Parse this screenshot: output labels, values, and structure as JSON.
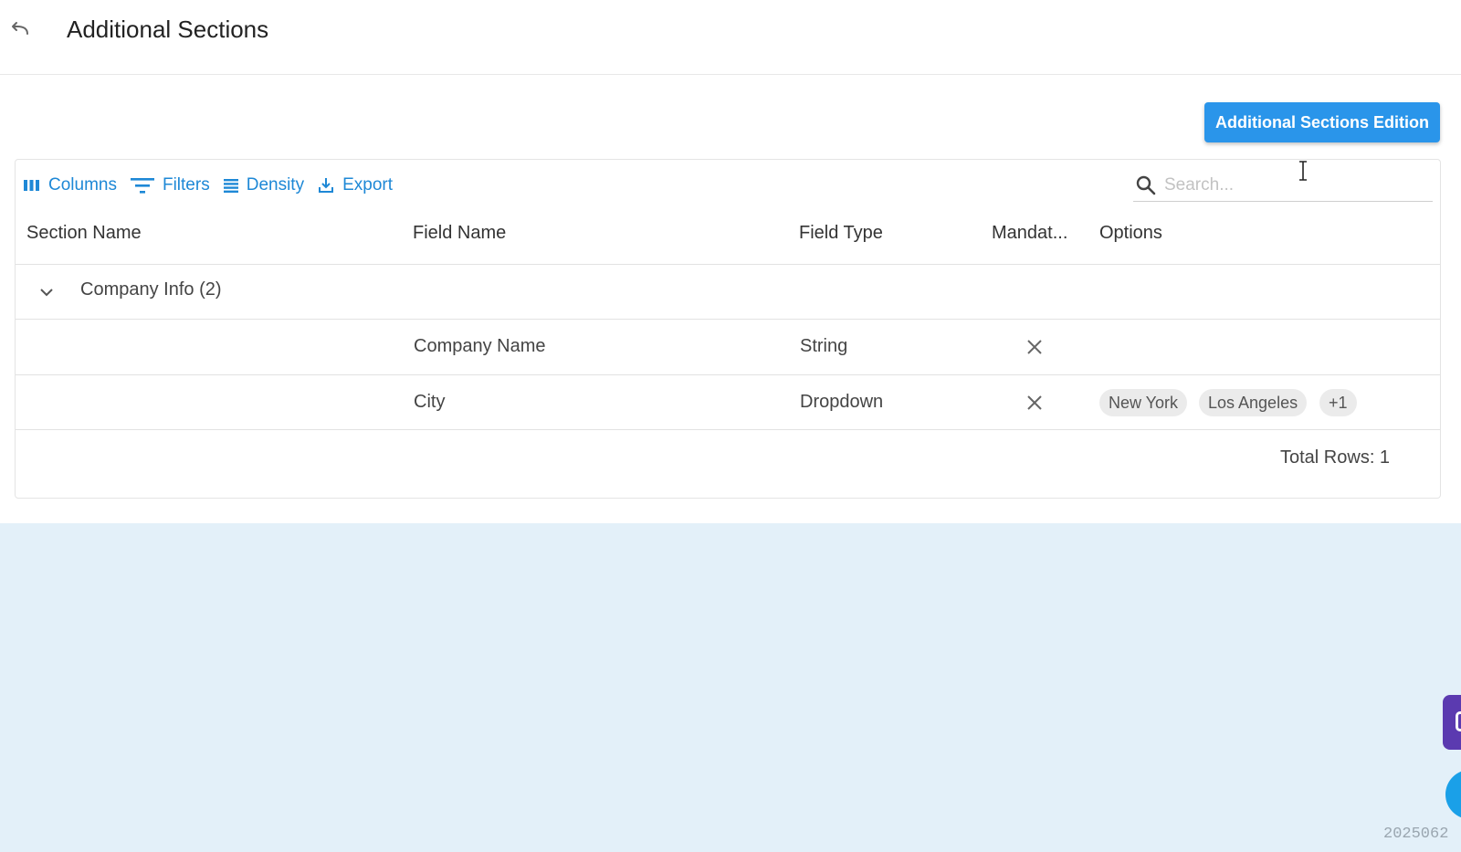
{
  "header": {
    "title": "Additional Sections",
    "back_icon": "back-arrow-icon"
  },
  "actions": {
    "edit_button_label": "Additional Sections Edition"
  },
  "toolbar": {
    "columns_label": "Columns",
    "filters_label": "Filters",
    "density_label": "Density",
    "export_label": "Export"
  },
  "search": {
    "placeholder": "Search..."
  },
  "table": {
    "columns": [
      "Section Name",
      "Field Name",
      "Field Type",
      "Mandat...",
      "Options"
    ],
    "group": {
      "label": "Company Info (2)",
      "expanded": true
    },
    "rows": [
      {
        "section_name": "",
        "field_name": "Company Name",
        "field_type": "String",
        "mandatory": false,
        "options": []
      },
      {
        "section_name": "",
        "field_name": "City",
        "field_type": "Dropdown",
        "mandatory": false,
        "options": [
          "New York",
          "Los Angeles"
        ],
        "options_more": "+1"
      }
    ],
    "footer": "Total Rows: 1"
  },
  "version": "2025062",
  "colors": {
    "primary": "#2a95ea",
    "toolbar_text": "#1e88d6",
    "page_bg": "#e3f0f9",
    "fab_purple": "#5b3ab0",
    "fab_blue": "#1aa0e8"
  }
}
